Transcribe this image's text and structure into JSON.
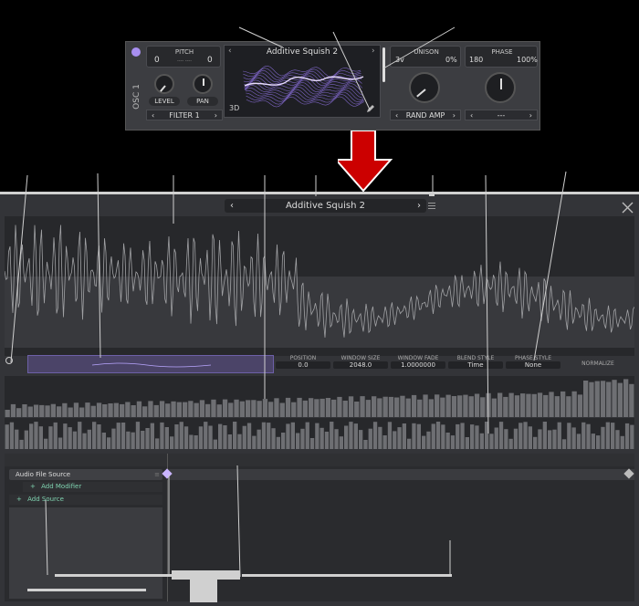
{
  "oscillator": {
    "label": "OSC 1",
    "pitch": {
      "label": "PITCH",
      "left": "0",
      "right": "0",
      "sub": "---- ----"
    },
    "level_label": "LEVEL",
    "pan_label": "PAN",
    "filter_select": "FILTER 1",
    "wavetable_name": "Additive Squish 2",
    "view_mode": "3D",
    "unison": {
      "label": "UNISON",
      "voices": "3v",
      "detune": "0%"
    },
    "phase": {
      "label": "PHASE",
      "value": "180",
      "random": "100%"
    },
    "rand_amp_select": "RAND AMP",
    "phase_select": "---"
  },
  "editor": {
    "title": "Additive Squish 2",
    "columns": [
      {
        "header": "POSITION",
        "value": "0.0"
      },
      {
        "header": "WINDOW SIZE",
        "value": "2048.0"
      },
      {
        "header": "WINDOW FADE",
        "value": "1.0000000"
      },
      {
        "header": "BLEND STYLE",
        "value": "Time"
      },
      {
        "header": "PHASE STYLE",
        "value": "None"
      }
    ],
    "normalize_label": "NORMALIZE",
    "sources": {
      "item": "Audio File Source",
      "add_modifier": "Add Modifier",
      "add_source": "Add Source"
    }
  },
  "colors": {
    "accent": "#a88ff0",
    "arrow": "#cc0000",
    "panel": "#333438",
    "plot_bg": "#27282b",
    "wave": "#9a9b9e",
    "add_text": "#7fd3b0"
  },
  "icons": [
    "power-icon",
    "chevron-left-icon",
    "chevron-right-icon",
    "pencil-icon",
    "menu-icon",
    "close-icon",
    "diamond-keyframe-icon",
    "plus-icon"
  ]
}
